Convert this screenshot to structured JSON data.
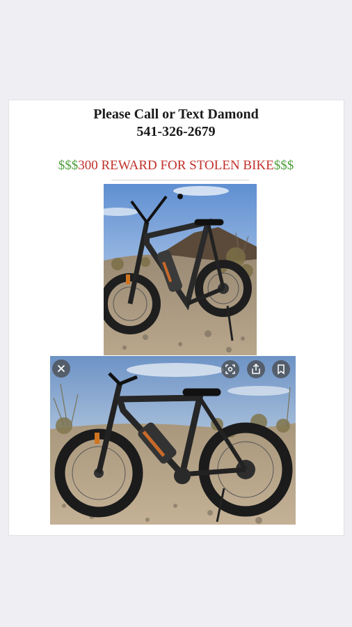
{
  "flyer": {
    "call_line": "Please Call or Text Damond",
    "phone": "541-326-2679",
    "reward_prefix": "$$$",
    "reward_text": "300 REWARD FOR STOLEN BIKE",
    "reward_suffix": "$$$"
  },
  "photos": [
    {
      "name": "bike-photo-front",
      "scene": "e-bike beside desert shrubs under blue sky"
    },
    {
      "name": "bike-photo-side",
      "scene": "e-bike on desert trail, side view"
    }
  ],
  "image_viewer_controls": {
    "icons": [
      "close-icon",
      "visual-search-icon",
      "share-icon",
      "bookmark-icon"
    ]
  },
  "colors": {
    "page_background": "#eeeef3",
    "card_background": "#ffffff",
    "reward_money_green": "#4f9e3b",
    "reward_text_red": "#c0302b",
    "headline_text": "#1a1a1a"
  }
}
